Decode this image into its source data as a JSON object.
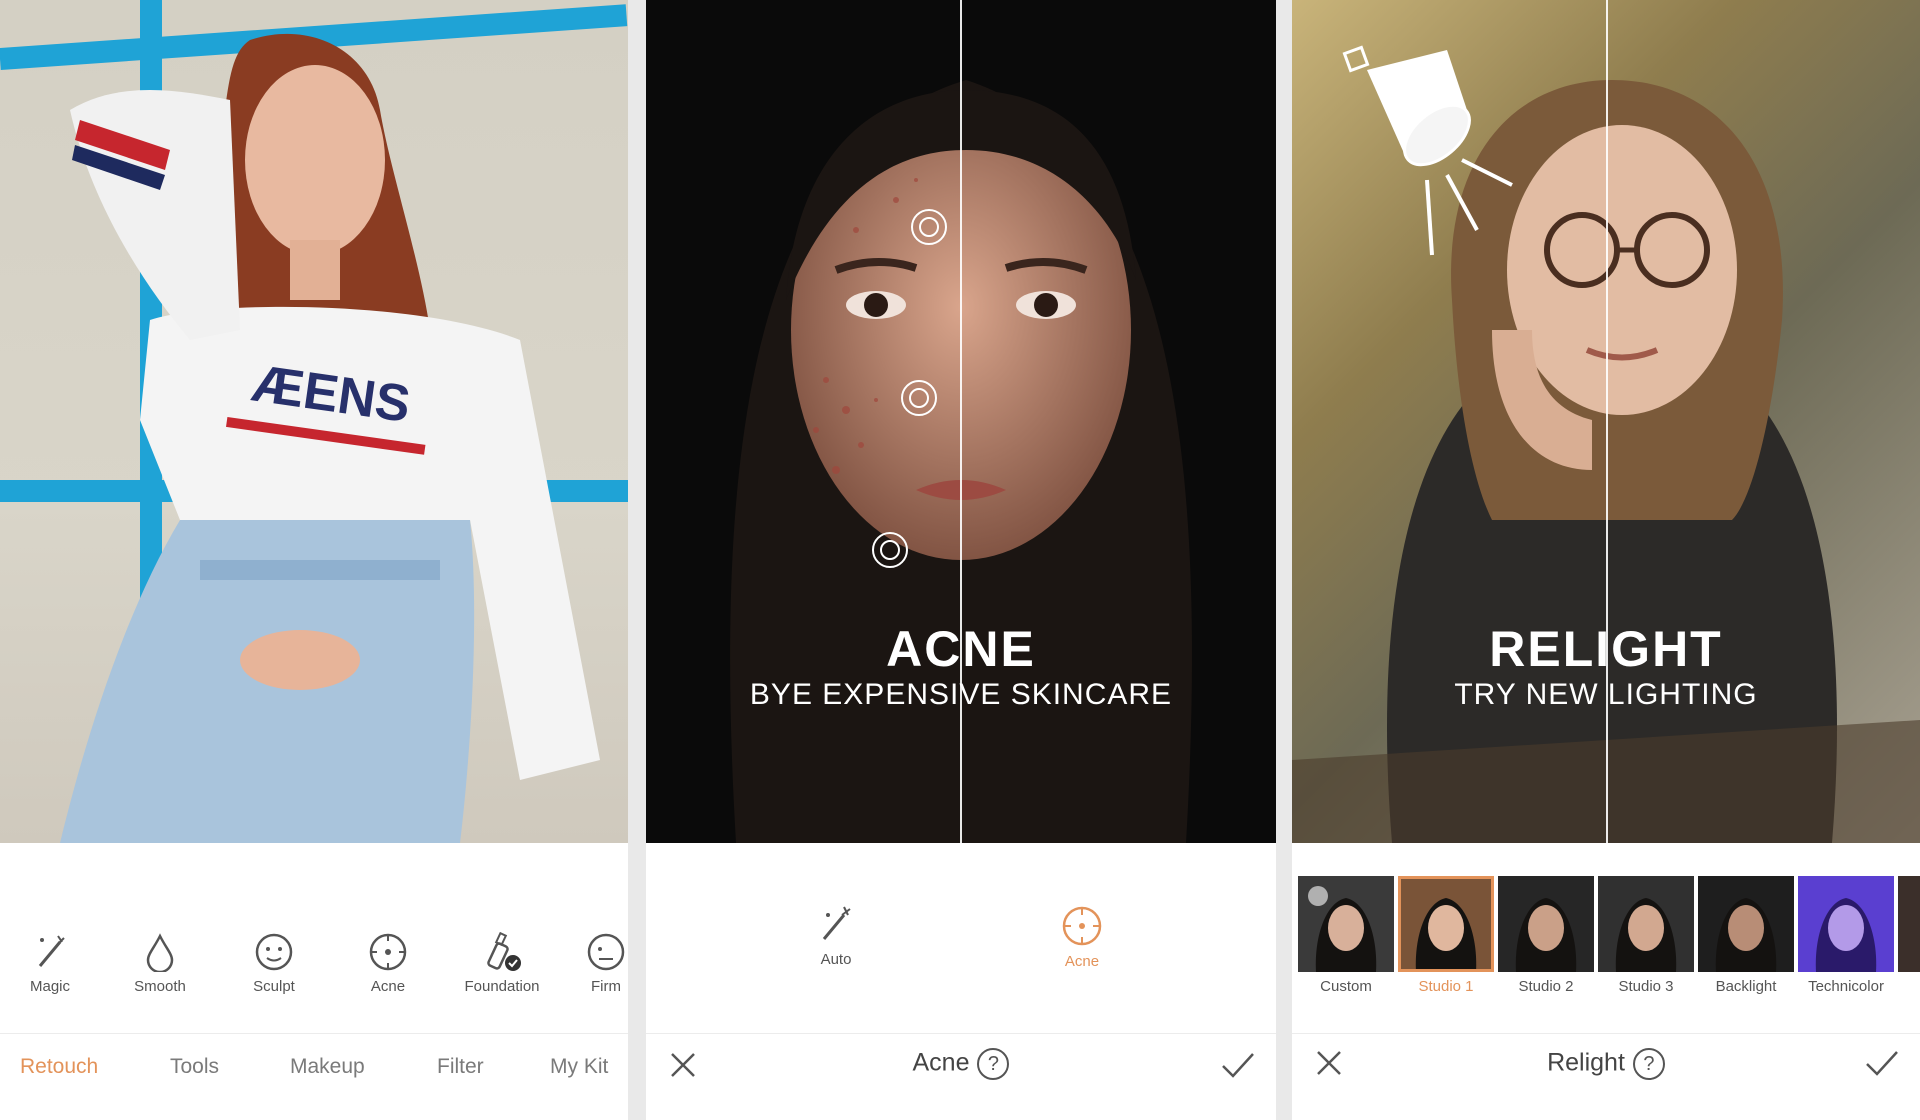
{
  "panel_retouch": {
    "tools": [
      {
        "label": "Magic",
        "icon": "magic-wand-icon"
      },
      {
        "label": "Smooth",
        "icon": "droplet-icon"
      },
      {
        "label": "Sculpt",
        "icon": "face-icon"
      },
      {
        "label": "Acne",
        "icon": "acne-target-icon"
      },
      {
        "label": "Foundation",
        "icon": "foundation-bottle-icon"
      },
      {
        "label": "Firm",
        "icon": "firm-face-icon"
      }
    ],
    "tabs": [
      {
        "label": "Retouch",
        "active": true
      },
      {
        "label": "Tools",
        "active": false
      },
      {
        "label": "Makeup",
        "active": false
      },
      {
        "label": "Filter",
        "active": false
      },
      {
        "label": "My Kit",
        "active": false
      }
    ]
  },
  "panel_acne": {
    "headline": "ACNE",
    "subheadline": "BYE EXPENSIVE SKINCARE",
    "modes": [
      {
        "label": "Auto",
        "icon": "magic-wand-icon",
        "active": false
      },
      {
        "label": "Acne",
        "icon": "acne-target-icon",
        "active": true
      }
    ],
    "action_title": "Acne",
    "help": "?",
    "cancel_icon": "close-icon",
    "confirm_icon": "checkmark-icon"
  },
  "panel_relight": {
    "headline": "RELIGHT",
    "subheadline": "TRY NEW LIGHTING",
    "filters": [
      {
        "label": "Custom",
        "selected": false
      },
      {
        "label": "Studio 1",
        "selected": true
      },
      {
        "label": "Studio 2",
        "selected": false
      },
      {
        "label": "Studio 3",
        "selected": false
      },
      {
        "label": "Backlight",
        "selected": false
      },
      {
        "label": "Technicolor",
        "selected": false
      }
    ],
    "action_title": "Relight",
    "help": "?",
    "cancel_icon": "close-icon",
    "confirm_icon": "checkmark-icon"
  },
  "colors": {
    "accent": "#e3935a",
    "grid_blue": "#1fa3d6",
    "label_gray": "#555555"
  }
}
